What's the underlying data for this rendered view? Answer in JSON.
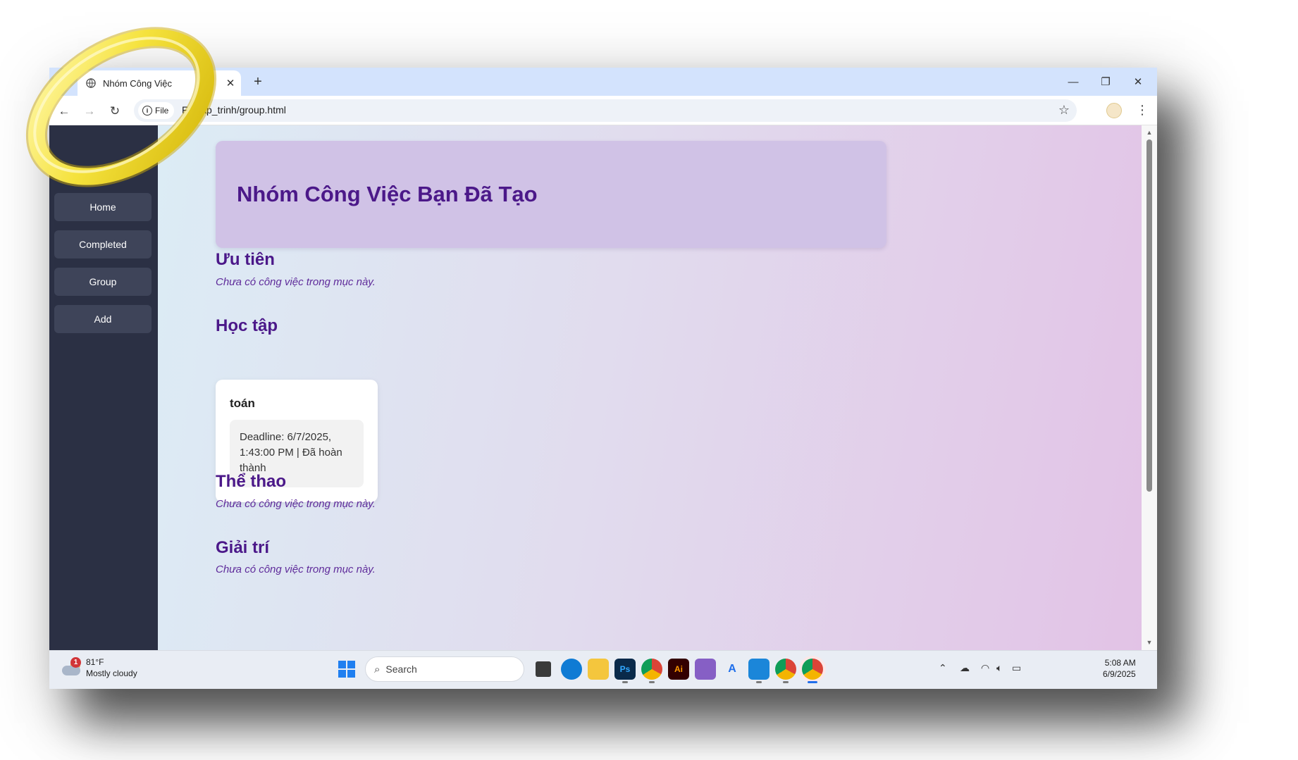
{
  "browser": {
    "tab_title": "Nhóm Công Việc",
    "chip_label": "File",
    "url": "F:/_lap_trinh/group.html"
  },
  "sidebar": {
    "items": [
      {
        "label": "Home"
      },
      {
        "label": "Completed"
      },
      {
        "label": "Group"
      },
      {
        "label": "Add"
      }
    ]
  },
  "main": {
    "header_title": "Nhóm Công Việc Bạn Đã Tạo",
    "empty_message": "Chưa có công việc trong mục này.",
    "sections": [
      {
        "title": "Ưu tiên"
      },
      {
        "title": "Học tập"
      },
      {
        "title": "Thể thao"
      },
      {
        "title": "Giải trí"
      }
    ],
    "task": {
      "name": "toán",
      "detail": "Deadline: 6/7/2025, 1:43:00 PM | Đã hoàn thành"
    }
  },
  "taskbar": {
    "weather_temp": "81°F",
    "weather_desc": "Mostly cloudy",
    "weather_badge": "1",
    "search_placeholder": "Search",
    "time": "5:08 AM",
    "date": "6/9/2025"
  },
  "colors": {
    "sidebar_bg": "#2b3044",
    "heading": "#4b1889",
    "header_card": "#d0c2e6",
    "ring": "#f5e23c"
  }
}
